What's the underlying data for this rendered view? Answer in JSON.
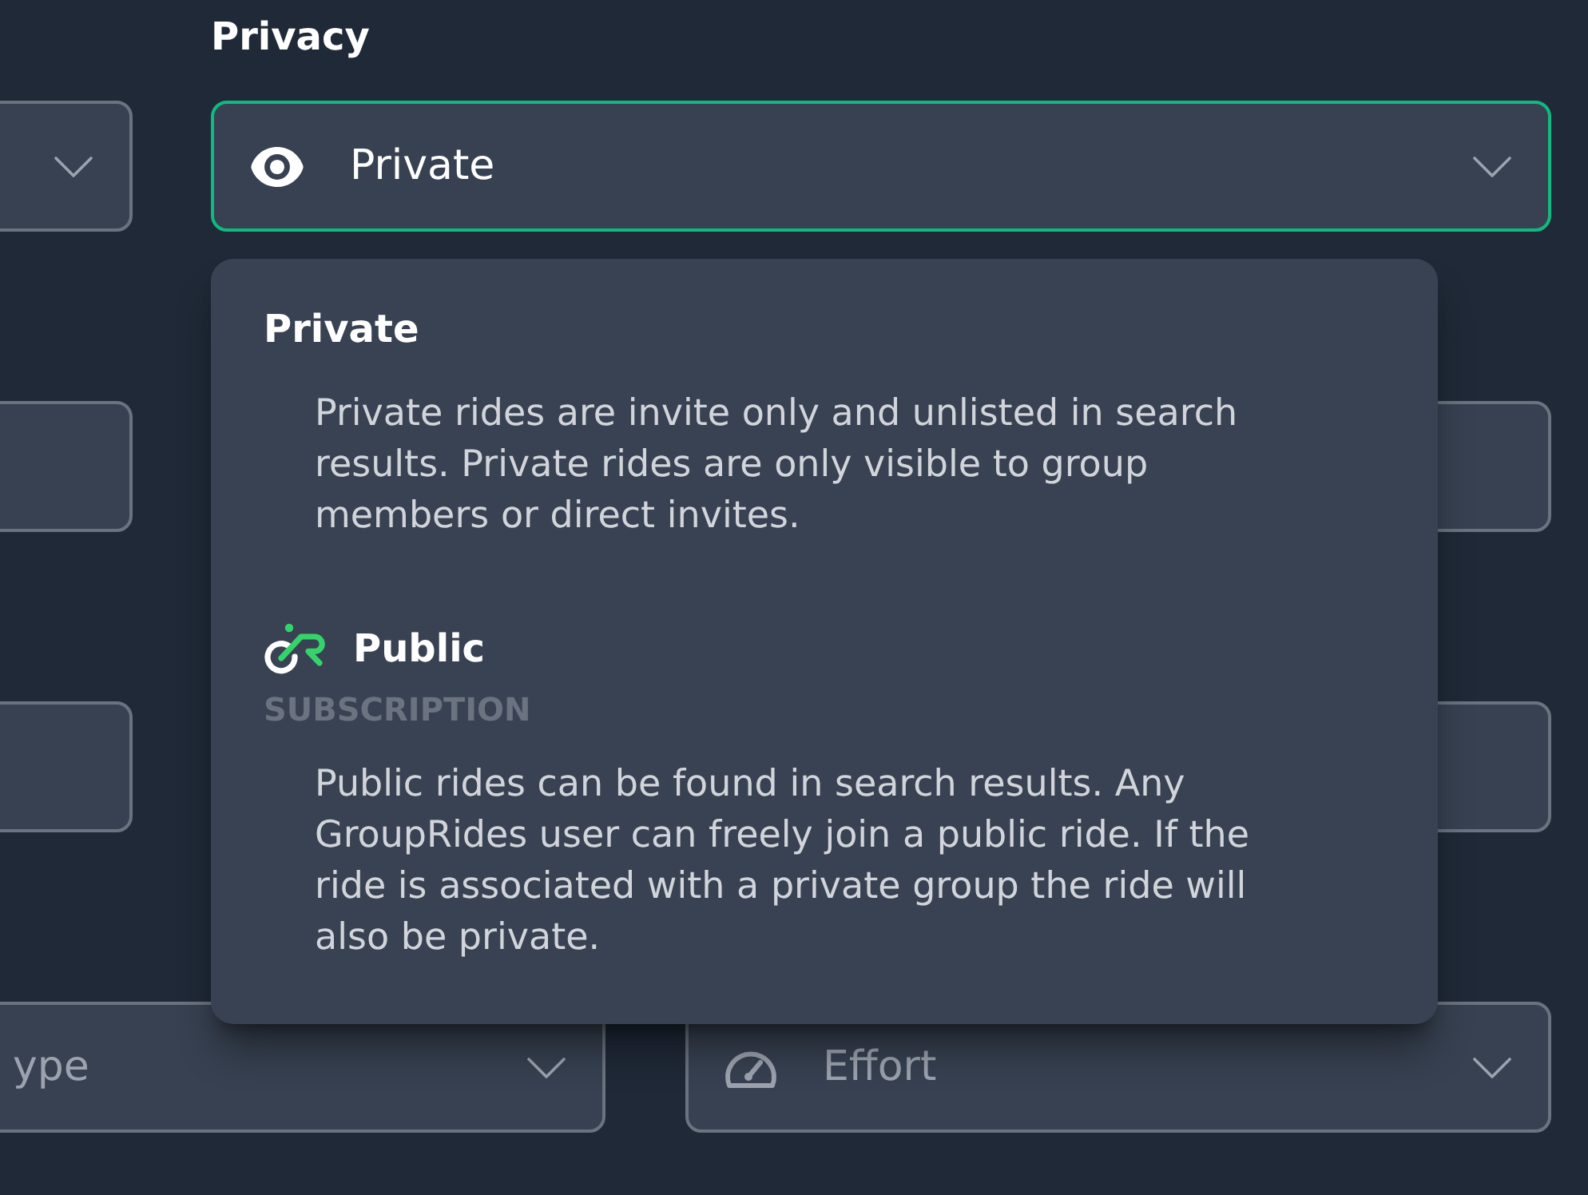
{
  "left_column": [
    {
      "kind": "select",
      "focused": false
    },
    {
      "kind": "input",
      "focused": false
    },
    {
      "kind": "input",
      "focused": false
    },
    {
      "kind": "select",
      "placeholder": "ype",
      "focused": false
    }
  ],
  "right_column": [
    {
      "kind": "select",
      "label": "Privacy",
      "value": "Private",
      "focused": true
    },
    {
      "kind": "input",
      "focused": false
    },
    {
      "kind": "input",
      "focused": false
    },
    {
      "kind": "select",
      "placeholder": "Effort",
      "focused": false
    }
  ],
  "privacy_menu": {
    "options": [
      {
        "kind": "plain",
        "title": "Private",
        "description": "Private rides are invite only and unlisted in search results. Private rides are only visible to group members or direct invites."
      },
      {
        "kind": "subscription",
        "title": "Public",
        "tag": "SUBSCRIPTION",
        "description": "Public rides can be found in search results. Any GroupRides user can freely join a public ride. If the ride is associated with a private group the ride will also be private."
      }
    ]
  }
}
